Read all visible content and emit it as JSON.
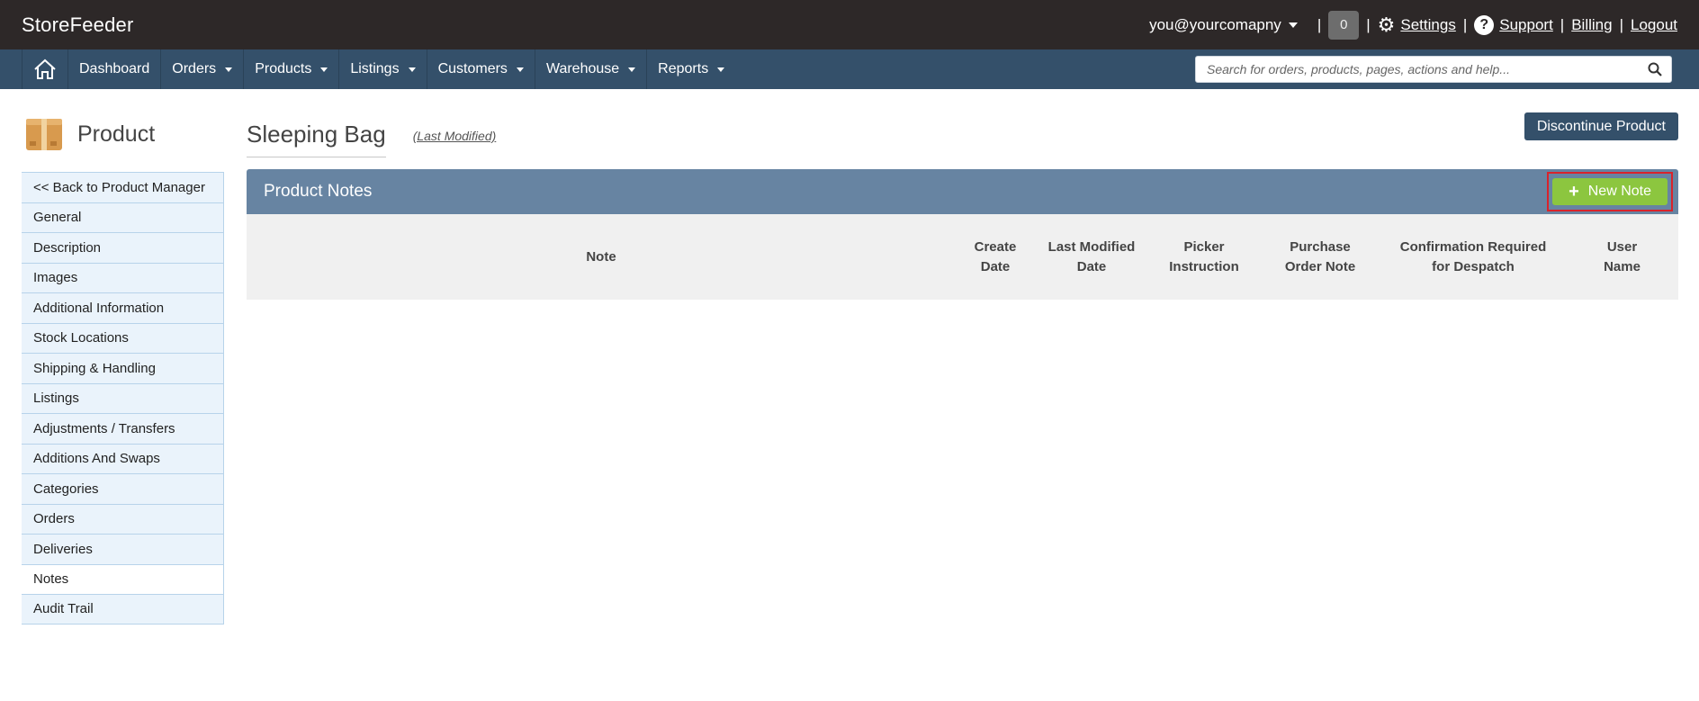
{
  "app": {
    "brand": "StoreFeeder",
    "user_email": "you@yourcomapny",
    "notification_count": "0",
    "links": {
      "settings": "Settings",
      "support": "Support",
      "billing": "Billing",
      "logout": "Logout"
    },
    "separator": "|"
  },
  "nav": {
    "items": [
      {
        "label": "Dashboard",
        "dropdown": false
      },
      {
        "label": "Orders",
        "dropdown": true
      },
      {
        "label": "Products",
        "dropdown": true
      },
      {
        "label": "Listings",
        "dropdown": true
      },
      {
        "label": "Customers",
        "dropdown": true
      },
      {
        "label": "Warehouse",
        "dropdown": true
      },
      {
        "label": "Reports",
        "dropdown": true
      }
    ],
    "search_placeholder": "Search for orders, products, pages, actions and help..."
  },
  "sidebar": {
    "title": "Product",
    "items": [
      {
        "label": "<< Back to Product Manager"
      },
      {
        "label": "General"
      },
      {
        "label": "Description"
      },
      {
        "label": "Images"
      },
      {
        "label": "Additional Information"
      },
      {
        "label": "Stock Locations"
      },
      {
        "label": "Shipping & Handling"
      },
      {
        "label": "Listings"
      },
      {
        "label": "Adjustments / Transfers"
      },
      {
        "label": "Additions And Swaps"
      },
      {
        "label": "Categories"
      },
      {
        "label": "Orders"
      },
      {
        "label": "Deliveries"
      },
      {
        "label": "Notes",
        "active": true
      },
      {
        "label": "Audit Trail"
      }
    ]
  },
  "main": {
    "product_name": "Sleeping Bag",
    "last_modified_label": "(Last Modified)",
    "discontinue_label": "Discontinue Product",
    "panel_title": "Product Notes",
    "new_note_label": "New Note",
    "columns": [
      {
        "line1": "Note",
        "line2": ""
      },
      {
        "line1": "Create",
        "line2": "Date"
      },
      {
        "line1": "Last Modified",
        "line2": "Date"
      },
      {
        "line1": "Picker",
        "line2": "Instruction"
      },
      {
        "line1": "Purchase",
        "line2": "Order Note"
      },
      {
        "line1": "Confirmation Required",
        "line2": "for Despatch"
      },
      {
        "line1": "User",
        "line2": "Name"
      }
    ]
  },
  "colors": {
    "topbar": "#2d2828",
    "navbar": "#34506a",
    "panel_header": "#6784a2",
    "new_note_button": "#8cc63f",
    "highlight_border": "#d9232b",
    "sidebar_item_bg": "#eaf3fb"
  }
}
